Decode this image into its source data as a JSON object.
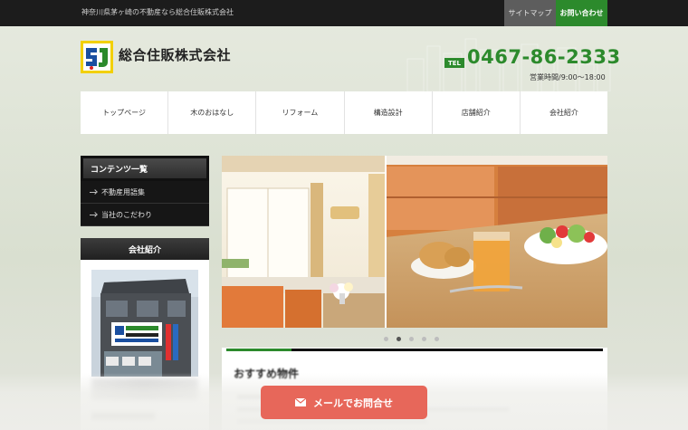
{
  "topbar": {
    "tagline": "神奈川県茅ヶ崎の不動産なら総合住販株式会社",
    "sitemap": "サイトマップ",
    "contact": "お問い合わせ"
  },
  "header": {
    "company": "総合住販株式会社",
    "tel_label": "TEL",
    "tel": "0467-86-2333",
    "hours": "営業時間/9:00～18:00"
  },
  "nav": [
    "トップページ",
    "木のおはなし",
    "リフォーム",
    "構造設計",
    "店舗紹介",
    "会社紹介"
  ],
  "sidebar": {
    "contents_title": "コンテンツ一覧",
    "contents_items": [
      "不動産用語集",
      "当社のこだわり"
    ],
    "company_title": "会社紹介"
  },
  "slider": {
    "dot_count": 5,
    "active_dot": 1
  },
  "featured": {
    "title": "おすすめ物件"
  },
  "cta": {
    "mail_label": "メールでお問合せ"
  },
  "colors": {
    "accent": "#2c8a2c",
    "cta": "#e7675a",
    "dark": "#111111"
  },
  "icons": [
    "logo-icon",
    "envelope-icon",
    "arrow-icon"
  ]
}
